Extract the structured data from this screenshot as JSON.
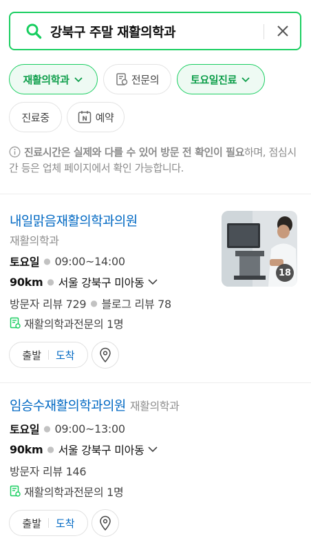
{
  "search": {
    "query": "강북구 주말 재활의학과"
  },
  "filters": [
    {
      "label": "재활의학과",
      "active": true,
      "dropdown": true
    },
    {
      "label": "전문의",
      "active": false,
      "icon": "specialist-doc-icon"
    },
    {
      "label": "토요일진료",
      "active": true,
      "dropdown": true
    },
    {
      "label": "진료중",
      "active": false
    },
    {
      "label": "예약",
      "active": false,
      "icon": "naver-n-icon"
    }
  ],
  "notice": {
    "bold": "진료시간은 실제와 다를 수 있어 방문 전 확인이 필요",
    "rest": "하며, 점심시간 등은 업체 페이지에서 확인 가능합니다."
  },
  "results": [
    {
      "name": "내일맑음재활의학과의원",
      "category": "재활의학과",
      "day": "토요일",
      "hours": "09:00~14:00",
      "distance": "90km",
      "address": "서울 강북구 미아동",
      "visitor_reviews": "방문자 리뷰 729",
      "blog_reviews": "블로그 리뷰 78",
      "specialist": "재활의학과전문의 1명",
      "photo_count": "18",
      "depart_label": "출발",
      "arrive_label": "도착"
    },
    {
      "name": "임승수재활의학과의원",
      "category": "재활의학과",
      "day": "토요일",
      "hours": "09:00~13:00",
      "distance": "90km",
      "address": "서울 강북구 미아동",
      "visitor_reviews": "방문자 리뷰 146",
      "specialist": "재활의학과전문의 1명",
      "depart_label": "출발",
      "arrive_label": "도착"
    }
  ],
  "colors": {
    "brand_green": "#19ce60",
    "link_blue": "#0068c3"
  }
}
